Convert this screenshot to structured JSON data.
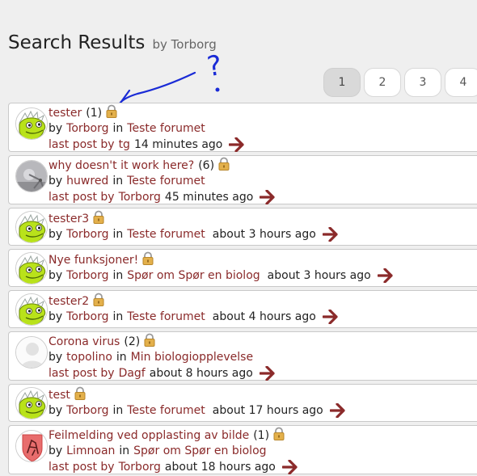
{
  "header": {
    "title": "Search Results",
    "by_label": "by Torborg"
  },
  "pagination": {
    "pages": [
      "1",
      "2",
      "3",
      "4"
    ],
    "current": "1"
  },
  "annotation": {
    "text": "?"
  },
  "labels": {
    "by": "by",
    "in": "in",
    "last_post_by": "last post by"
  },
  "results": [
    {
      "title": "tester",
      "count": "(1)",
      "author": "Torborg",
      "forum": "Teste forumet",
      "last_post_by": "tg",
      "time": "14 minutes ago",
      "avatar": "dino"
    },
    {
      "title": "why doesn't it work here?",
      "count": "(6)",
      "author": "huwred",
      "forum": "Teste forumet",
      "last_post_by": "Torborg",
      "time": "45 minutes ago",
      "avatar": "photo"
    },
    {
      "title": "tester3",
      "author": "Torborg",
      "forum": "Teste forumet",
      "time": "about 3 hours ago",
      "avatar": "dino"
    },
    {
      "title": "Nye funksjoner!",
      "author": "Torborg",
      "forum": "Spør om Spør en biolog",
      "time": "about 3 hours ago",
      "avatar": "dino"
    },
    {
      "title": "tester2",
      "author": "Torborg",
      "forum": "Teste forumet",
      "time": "about 4 hours ago",
      "avatar": "dino"
    },
    {
      "title": "Corona virus",
      "count": "(2)",
      "author": "topolino",
      "forum": "Min biologiopplevelse",
      "last_post_by": "Dagf",
      "time": "about 8 hours ago",
      "avatar": "default"
    },
    {
      "title": "test",
      "author": "Torborg",
      "forum": "Teste forumet",
      "time": "about 17 hours ago",
      "avatar": "dino"
    },
    {
      "title": "Feilmelding ved opplasting av bilde",
      "count": "(1)",
      "author": "Limnoan",
      "forum": "Spør om Spør en biolog",
      "last_post_by": "Torborg",
      "time": "about 18 hours ago",
      "avatar": "shield"
    }
  ],
  "colors": {
    "link": "#8a2a2a",
    "arrow": "#8b2a2a",
    "annotation": "#1a2bd6",
    "lock": "#d8a83a"
  }
}
